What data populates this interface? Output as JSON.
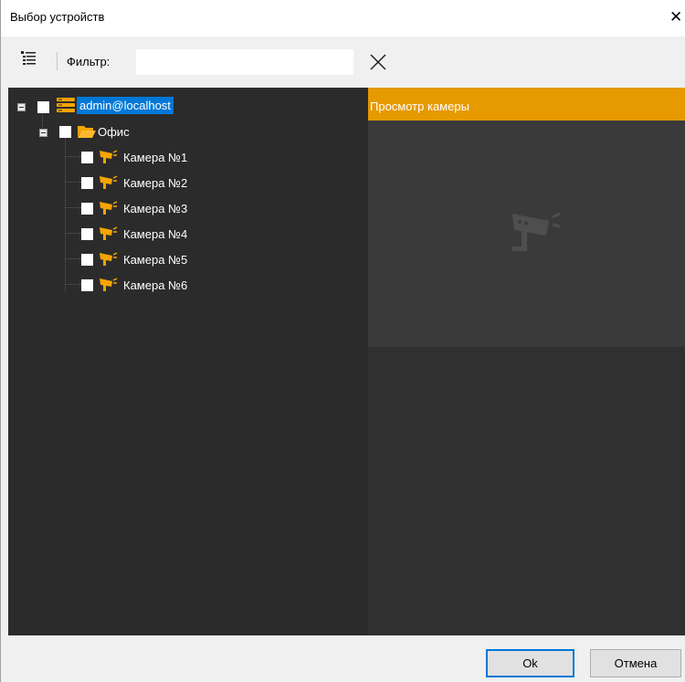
{
  "window": {
    "title": "Выбор устройств"
  },
  "toolbar": {
    "filter_label": "Фильтр:",
    "filter_value": "",
    "list_icon": "list-view-icon",
    "clear_icon": "close-icon"
  },
  "tree": {
    "root": {
      "label": "admin@localhost",
      "icon": "server-icon",
      "checked": false,
      "expanded": true
    },
    "folder": {
      "label": "Офис",
      "icon": "folder-open-icon",
      "checked": false,
      "expanded": true
    },
    "cameras": [
      {
        "label": "Камера №1",
        "icon": "camera-icon",
        "checked": false
      },
      {
        "label": "Камера №2",
        "icon": "camera-icon",
        "checked": false
      },
      {
        "label": "Камера №3",
        "icon": "camera-icon",
        "checked": false
      },
      {
        "label": "Камера №4",
        "icon": "camera-icon",
        "checked": false
      },
      {
        "label": "Камера №5",
        "icon": "camera-icon",
        "checked": false
      },
      {
        "label": "Камера №6",
        "icon": "camera-icon",
        "checked": false
      }
    ]
  },
  "preview": {
    "header": "Просмотр камеры",
    "placeholder_icon": "camera-placeholder-icon"
  },
  "footer": {
    "ok_label": "Ok",
    "cancel_label": "Отмена"
  },
  "colors": {
    "accent": "#e69a00",
    "selection": "#0078d7",
    "tree_background": "#2b2b2b",
    "preview_background": "#3a3a3a"
  }
}
